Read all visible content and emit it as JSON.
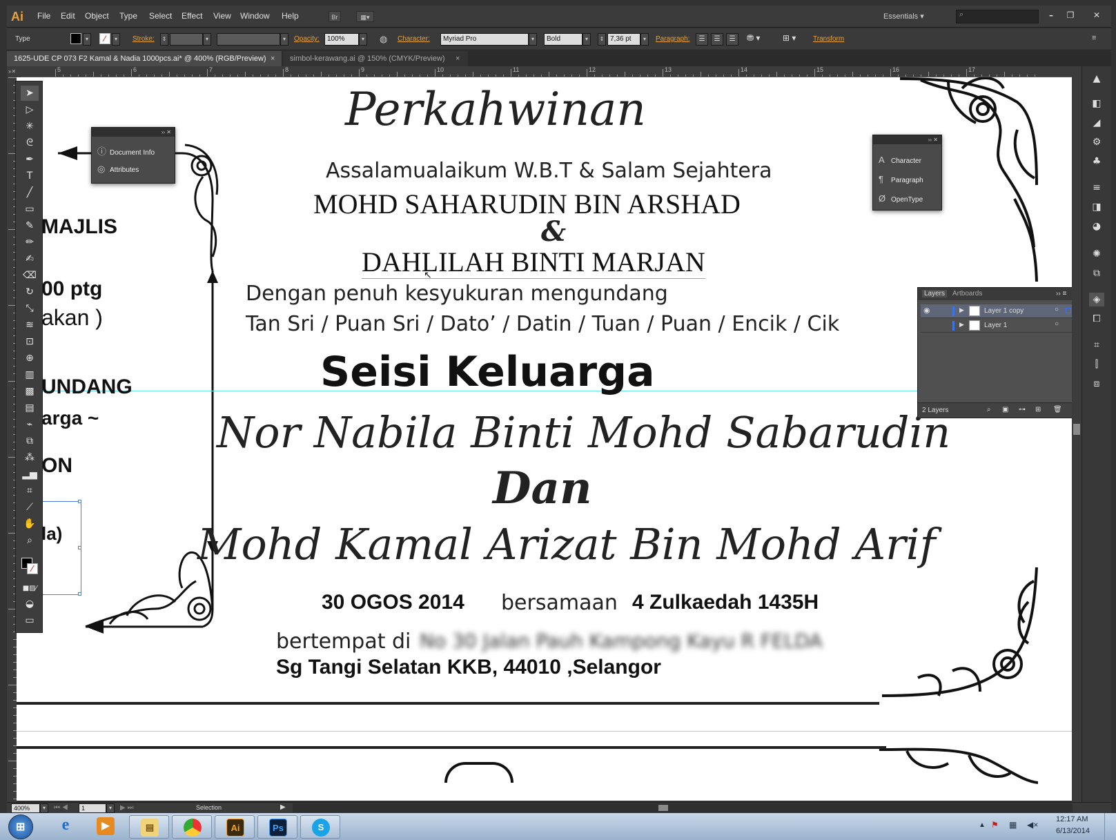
{
  "app": {
    "logo": "Ai"
  },
  "menubar": {
    "items": [
      "File",
      "Edit",
      "Object",
      "Type",
      "Select",
      "Effect",
      "View",
      "Window",
      "Help"
    ],
    "bridge_label": "Br",
    "workspace": "Essentials",
    "search_placeholder": ""
  },
  "control": {
    "type_label": "Type",
    "stroke_label": "Stroke:",
    "opacity_label": "Opacity:",
    "opacity_value": "100%",
    "character_label": "Character:",
    "font_family": "Myriad Pro",
    "font_style": "Bold",
    "font_size": "7,36 pt",
    "paragraph_label": "Paragraph:",
    "transform_label": "Transform"
  },
  "tabs": [
    {
      "label": "1625-UDE CP 073 F2 Kamal & Nadia 1000pcs.ai* @ 400% (RGB/Preview)"
    },
    {
      "label": "simbol-kerawang.ai @ 150% (CMYK/Preview)"
    }
  ],
  "ruler": {
    "numbers": [
      "5",
      "6",
      "7",
      "8",
      "9",
      "10",
      "11",
      "12",
      "13",
      "14",
      "15",
      "16",
      "17"
    ]
  },
  "panels": {
    "doc_panel": {
      "items": [
        "Document Info",
        "Attributes"
      ]
    },
    "char_panel": {
      "items": [
        "Character",
        "Paragraph",
        "OpenType"
      ]
    },
    "layers": {
      "tabs": [
        "Layers",
        "Artboards"
      ],
      "rows": [
        {
          "name": "Layer 1 copy"
        },
        {
          "name": "Layer 1"
        }
      ],
      "footer": "2 Layers"
    }
  },
  "document": {
    "left_fragments": [
      "MAJLIS",
      "00 ptg",
      "akan )",
      "UNDANG",
      "arga ~",
      "ON",
      "la)"
    ],
    "title": "Perkahwinan",
    "greeting": "Assalamualaikum W.B.T & Salam Sejahtera",
    "host1": "MOHD SAHARUDIN BIN ARSHAD",
    "ampersand": "&",
    "host2": "DAHLILAH BINTI MARJAN",
    "invite_line": "Dengan penuh kesyukuran mengundang",
    "honorifics": "Tan Sri / Puan Sri / Dato’ / Datin / Tuan / Puan / Encik / Cik",
    "family": "Seisi Keluarga",
    "bride": "Nor Nabila Binti Mohd Sabarudin",
    "dan": "Dan",
    "groom": "Mohd Kamal Arizat Bin Mohd Arif",
    "date": "30 OGOS 2014",
    "bersamaan": "bersamaan",
    "hijri": "4 Zulkaedah 1435H",
    "bertempat": "bertempat di",
    "address_blurred": "No 30 Jalan Pauh Kampong Kayu R FELDA",
    "address2": "Sg Tangi Selatan KKB, 44010 ,Selangor"
  },
  "status": {
    "zoom": "400%",
    "page": "1",
    "tool": "Selection"
  },
  "taskbar": {
    "time": "12:17 AM",
    "date": "6/13/2014",
    "apps": [
      "Ai",
      "Ps"
    ]
  }
}
